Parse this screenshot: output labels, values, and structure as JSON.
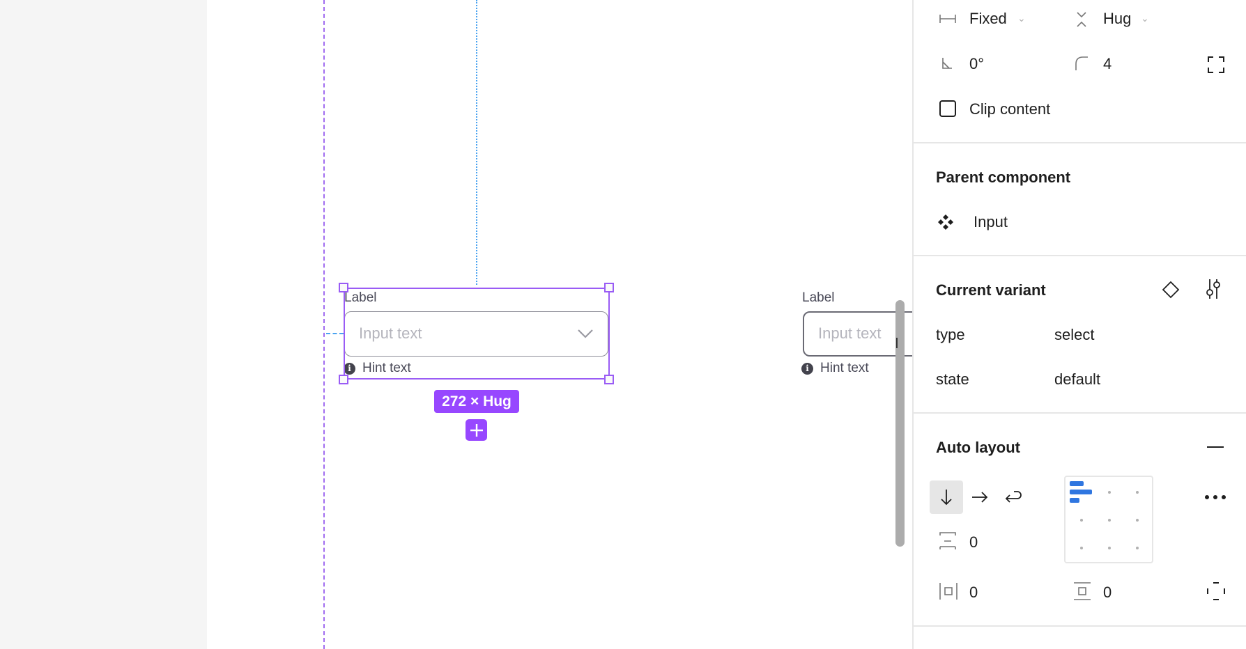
{
  "canvas": {
    "selected_component": {
      "label": "Label",
      "placeholder": "Input text",
      "hint": "Hint text",
      "size_badge": "272 × Hug"
    },
    "second_component": {
      "label": "Label",
      "placeholder": "Input text",
      "hint": "Hint text"
    },
    "colors": {
      "selection": "#9747ff",
      "guide_blue": "#4aa3f0"
    }
  },
  "panel": {
    "sizing": {
      "width_mode": "Fixed",
      "height_mode": "Hug",
      "rotation": "0°",
      "corner_radius": "4",
      "clip_content_label": "Clip content",
      "clip_content_checked": false
    },
    "parent_component": {
      "title": "Parent component",
      "name": "Input"
    },
    "current_variant": {
      "title": "Current variant",
      "properties": [
        {
          "name": "type",
          "value": "select"
        },
        {
          "name": "state",
          "value": "default"
        }
      ]
    },
    "auto_layout": {
      "title": "Auto layout",
      "direction": "vertical",
      "gap": "0",
      "horizontal_padding": "0",
      "vertical_padding": "0",
      "alignment": "top-left",
      "accent": "#2f76e0"
    }
  }
}
